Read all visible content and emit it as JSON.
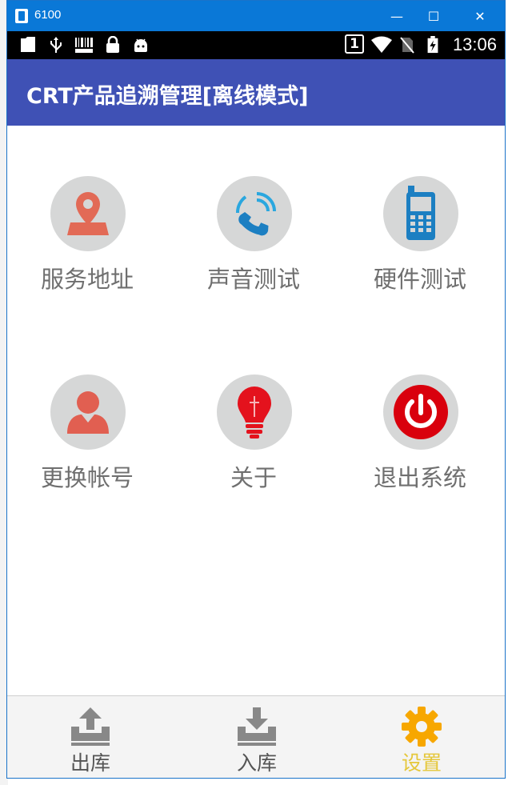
{
  "window": {
    "title": "6100",
    "minimize_glyph": "—",
    "maximize_glyph": "☐",
    "close_glyph": "✕"
  },
  "statusbar": {
    "icons": [
      "photo-icon",
      "usb-icon",
      "barcode-icon",
      "lock-icon",
      "android-icon",
      "sim-1-icon",
      "wifi-icon",
      "no-sim-icon",
      "battery-charging-icon"
    ],
    "sim_number": "1",
    "time": "13:06"
  },
  "appbar": {
    "title": "CRT产品追溯管理[离线模式]",
    "color": "#3f51b5"
  },
  "grid": {
    "items": [
      {
        "label": "服务地址",
        "icon": "map-pin-icon"
      },
      {
        "label": "声音测试",
        "icon": "phone-sound-icon"
      },
      {
        "label": "硬件测试",
        "icon": "mobile-phone-icon"
      },
      {
        "label": "更换帐号",
        "icon": "user-icon"
      },
      {
        "label": "关于",
        "icon": "lightbulb-icon"
      },
      {
        "label": "退出系统",
        "icon": "power-icon"
      }
    ]
  },
  "bottomnav": {
    "items": [
      {
        "label": "出库",
        "icon": "upload-tray-icon",
        "active": false
      },
      {
        "label": "入库",
        "icon": "download-tray-icon",
        "active": false
      },
      {
        "label": "设置",
        "icon": "gear-icon",
        "active": true
      }
    ],
    "active_color": "#e5c73a",
    "gear_color": "#f7a700"
  }
}
